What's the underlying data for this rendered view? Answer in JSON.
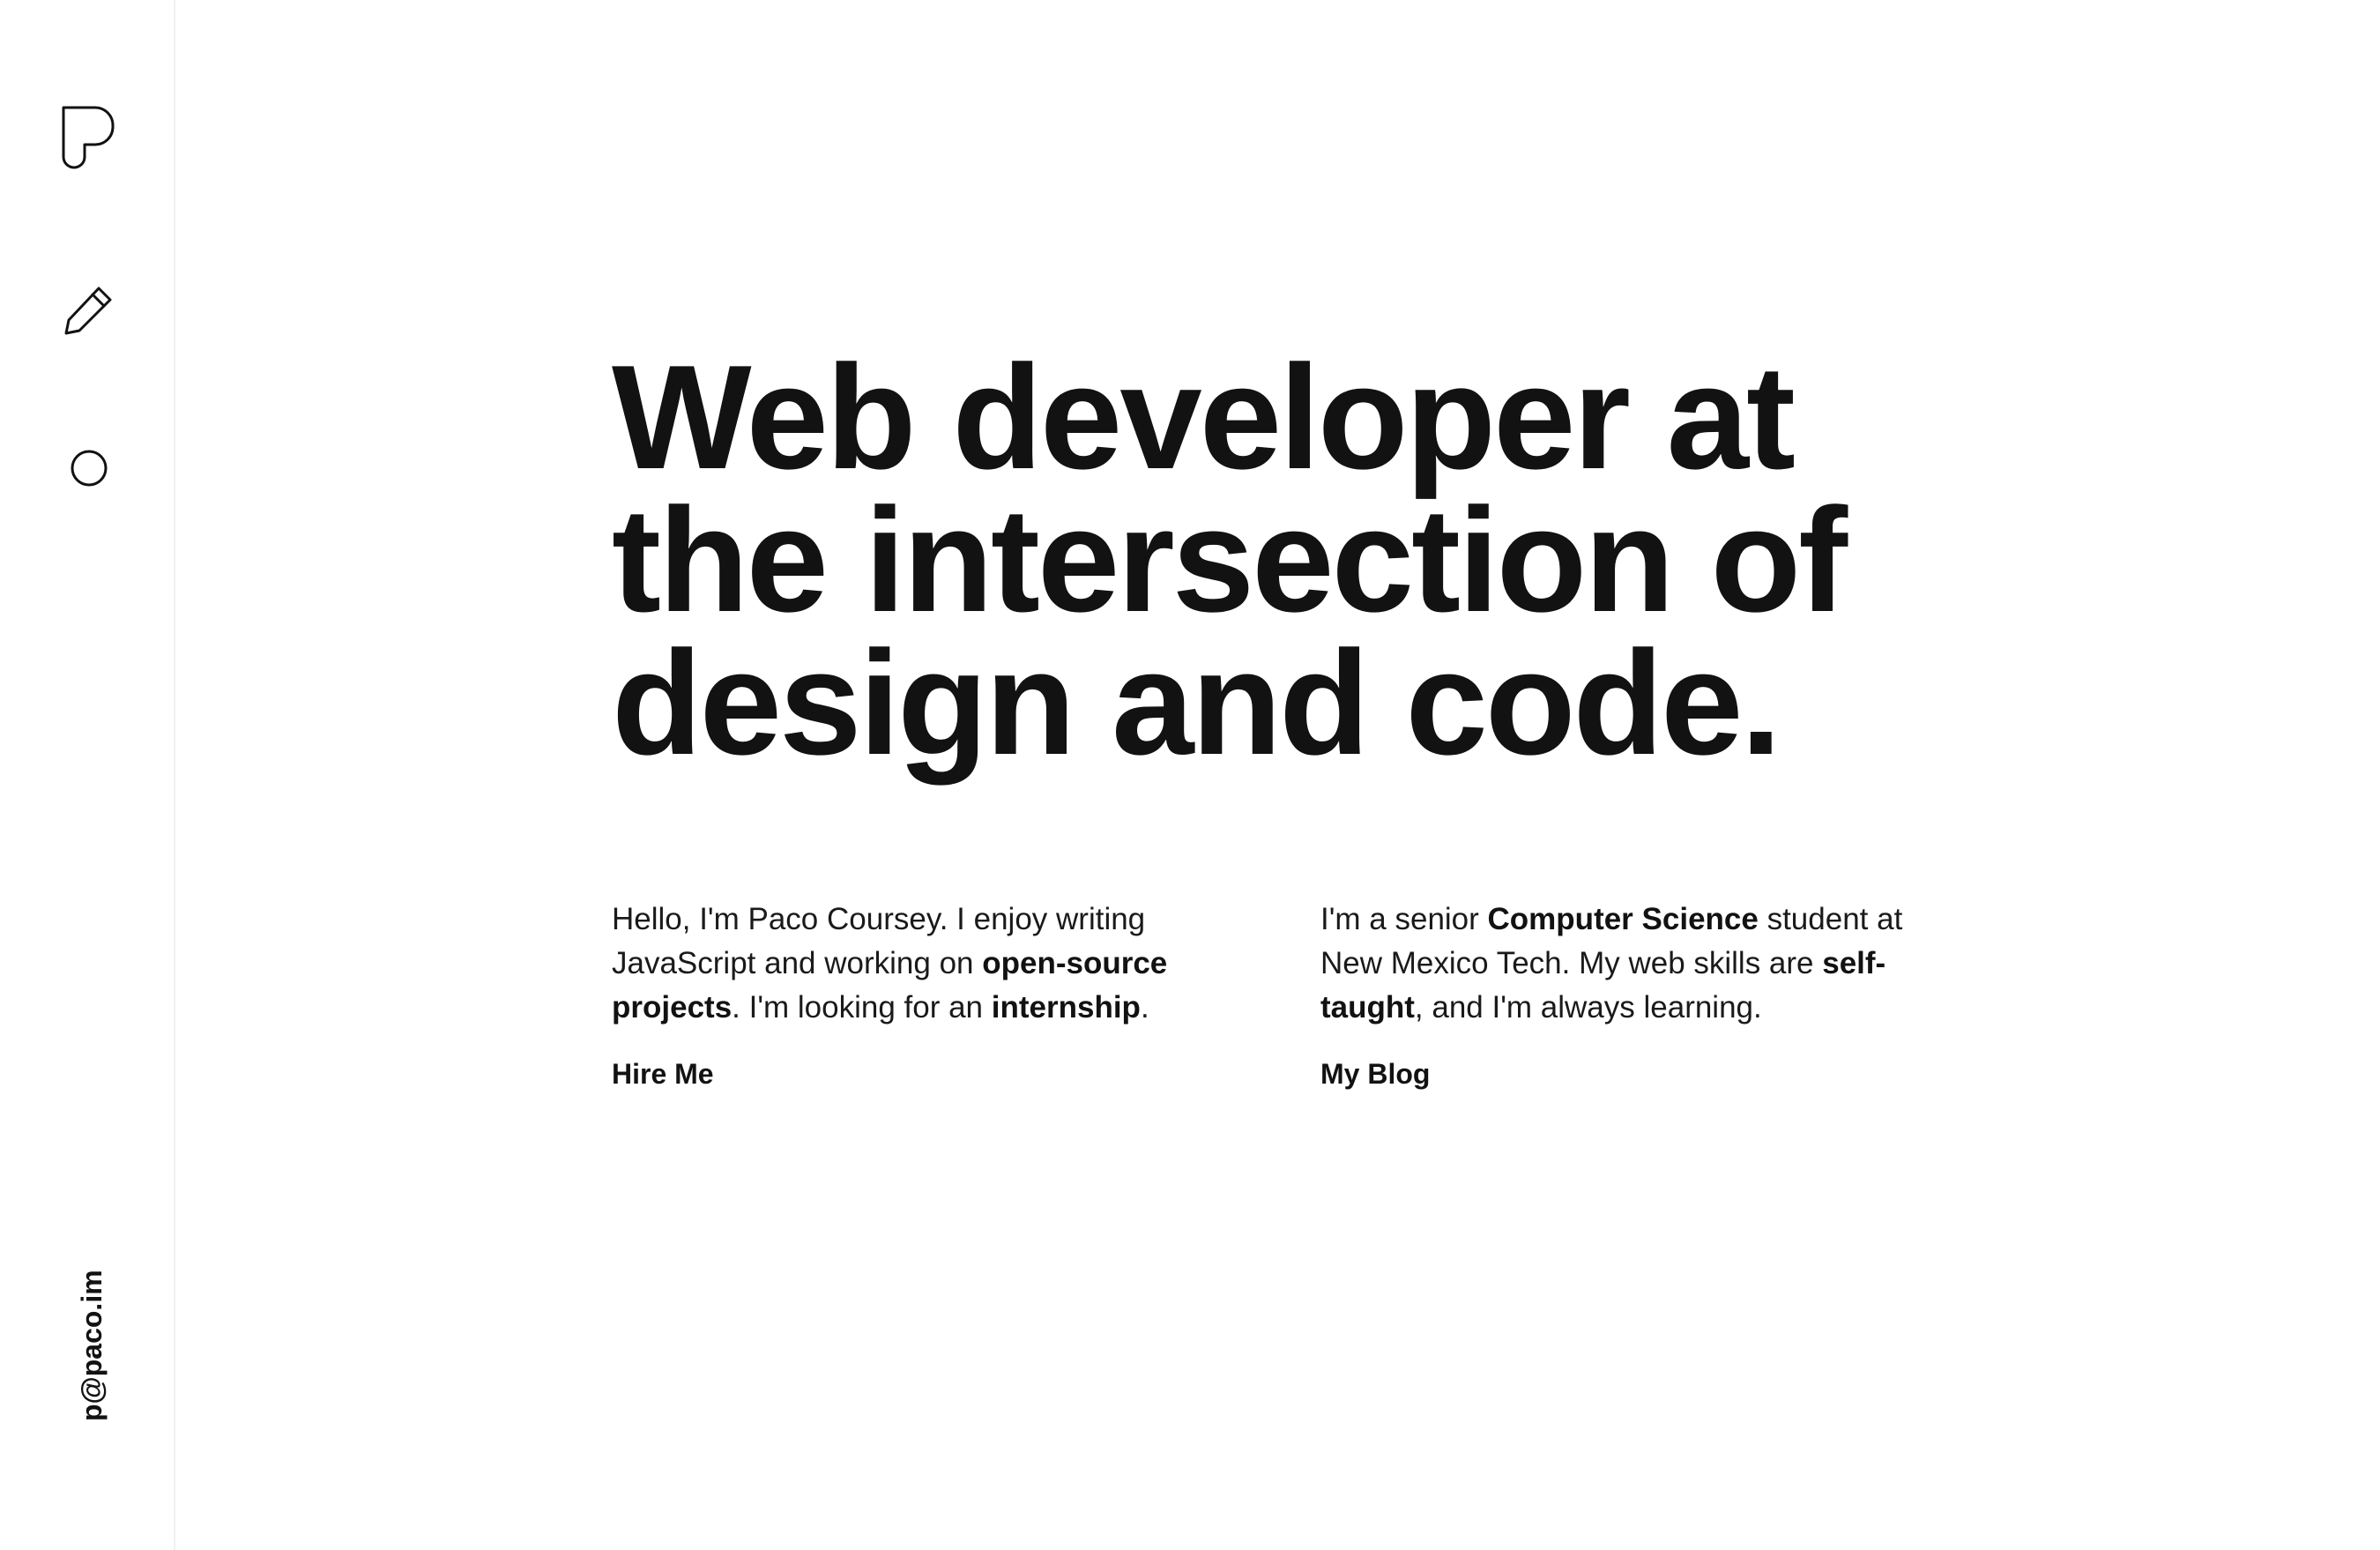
{
  "sidebar": {
    "nav": [
      {
        "icon": "logo-p-icon"
      },
      {
        "icon": "pencil-icon"
      },
      {
        "icon": "circle-icon"
      }
    ],
    "email": "p@paco.im"
  },
  "hero": {
    "headline_lines": [
      "Web developer at",
      "the intersection of",
      "design and code."
    ]
  },
  "intro": {
    "left": {
      "t1": "Hello, I'm Paco Coursey. I enjoy writing JavaScript and working on ",
      "b1": "open-source projects",
      "t2": ". I'm looking for an ",
      "b2": "internship",
      "t3": ".",
      "link": "Hire Me"
    },
    "right": {
      "t1": "I'm a senior ",
      "b1": "Computer Science",
      "t2": " student at New Mexico Tech. My web skills are ",
      "b2": "self-taught",
      "t3": ", and I'm always learning.",
      "link": "My Blog"
    }
  },
  "colors": {
    "text": "#121212",
    "background": "#ffffff",
    "divider": "#f0f0f0"
  }
}
